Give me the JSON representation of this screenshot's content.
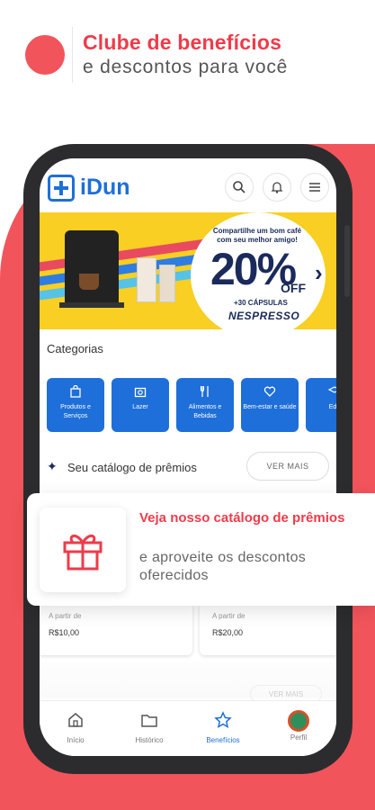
{
  "header": {
    "title": "Clube de benefícios",
    "subtitle": "e descontos para você"
  },
  "app": {
    "logo_text": "iDun",
    "top_icons": [
      "search-icon",
      "bell-icon",
      "menu-icon"
    ]
  },
  "banner": {
    "top_text": "Compartilhe um bom café com seu melhor amigo!",
    "discount": "20%",
    "off": "OFF",
    "capsules": "+30 CÁPSULAS",
    "brand": "NESPRESSO"
  },
  "categories": {
    "title": "Categorias",
    "items": [
      {
        "label": "Produtos e Serviços",
        "icon": "bag-icon"
      },
      {
        "label": "Lazer",
        "icon": "camera-icon"
      },
      {
        "label": "Alimentos e Bebidas",
        "icon": "cutlery-icon"
      },
      {
        "label": "Bem-estar e saúde",
        "icon": "heart-icon"
      },
      {
        "label": "Edu",
        "icon": "education-icon"
      }
    ]
  },
  "catalog": {
    "title": "Seu catálogo de prêmios",
    "button": "VER MAIS"
  },
  "products": [
    {
      "from": "A partir de",
      "price": "R$10,00"
    },
    {
      "from": "A partir de",
      "price": "R$20,00"
    }
  ],
  "faded_section": {
    "button": "VER MAIS"
  },
  "nav": {
    "items": [
      {
        "label": "Início",
        "icon": "home-icon",
        "active": false
      },
      {
        "label": "Histórico",
        "icon": "folder-icon",
        "active": false
      },
      {
        "label": "Benefícios",
        "icon": "star-icon",
        "active": true
      },
      {
        "label": "Perfil",
        "icon": "avatar",
        "active": false
      }
    ]
  },
  "promo_card": {
    "title": "Veja nosso catálogo de prêmios",
    "subtitle": "e aproveite os descontos oferecidos",
    "icon": "gift-icon"
  },
  "colors": {
    "accent_red": "#f2545b",
    "brand_blue": "#1e6fd9",
    "banner_yellow": "#f8cf22"
  }
}
